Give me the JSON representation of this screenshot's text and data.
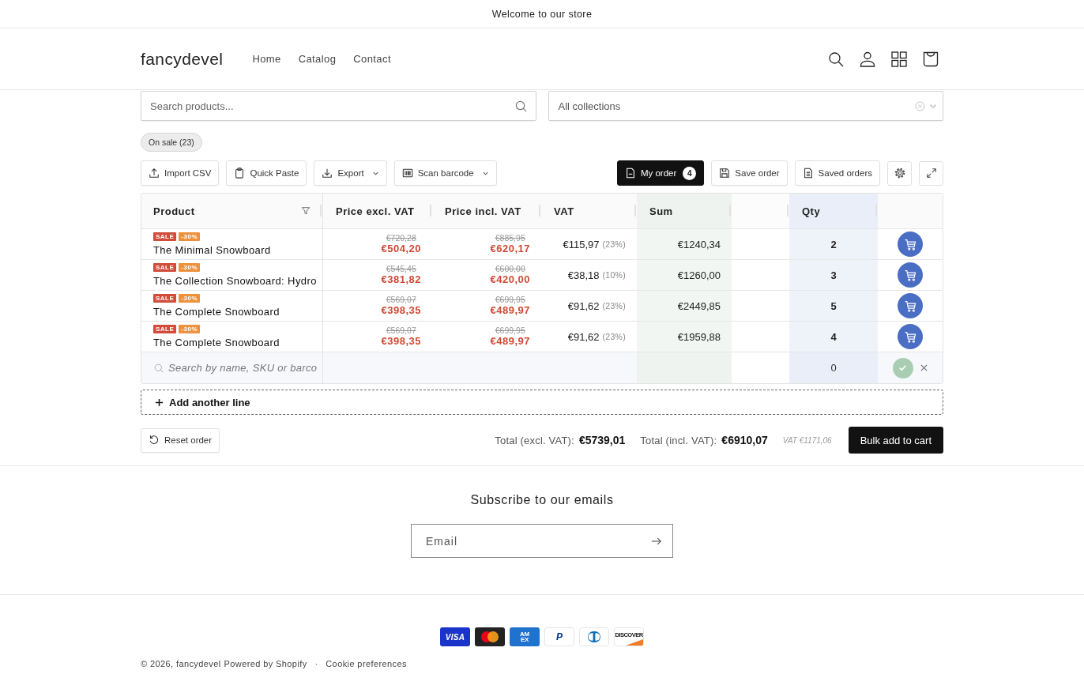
{
  "announcement": "Welcome to our store",
  "header": {
    "logo": "fancydevel",
    "nav": [
      {
        "label": "Home"
      },
      {
        "label": "Catalog"
      },
      {
        "label": "Contact"
      }
    ]
  },
  "filters": {
    "search": {
      "placeholder": "Search products..."
    },
    "collections": {
      "value": "All collections"
    },
    "chips": [
      {
        "label": "On sale (23)"
      }
    ]
  },
  "toolbar": {
    "left": [
      {
        "label": "Import CSV",
        "dropdown": false
      },
      {
        "label": "Quick Paste",
        "dropdown": false
      },
      {
        "label": "Export",
        "dropdown": true
      },
      {
        "label": "Scan barcode",
        "dropdown": true
      }
    ],
    "my_order": {
      "label": "My order",
      "count": "4",
      "active": true
    },
    "right": [
      {
        "label": "Save order"
      },
      {
        "label": "Saved orders"
      }
    ]
  },
  "table": {
    "columns": [
      "Product",
      "Price excl. VAT",
      "Price incl. VAT",
      "VAT",
      "Sum",
      "Qty"
    ],
    "rows": [
      {
        "badges": [
          {
            "label": "SALE",
            "color": "#d34b3b"
          },
          {
            "label": "-30%",
            "color": "#ef913b"
          }
        ],
        "name": "The Minimal Snowboard",
        "price_excl_old": "€720,28",
        "price_excl": "€504,20",
        "price_incl_old": "€885,95",
        "price_incl": "€620,17",
        "vat": "€115,97",
        "vat_rate": "(23%)",
        "sum": "€1240,34",
        "qty": "2"
      },
      {
        "badges": [
          {
            "label": "SALE",
            "color": "#d34b3b"
          },
          {
            "label": "-30%",
            "color": "#ef913b"
          }
        ],
        "name": "The Collection Snowboard: Hydro",
        "price_excl_old": "€545,45",
        "price_excl": "€381,82",
        "price_incl_old": "€600,00",
        "price_incl": "€420,00",
        "vat": "€38,18",
        "vat_rate": "(10%)",
        "sum": "€1260,00",
        "qty": "3"
      },
      {
        "badges": [
          {
            "label": "SALE",
            "color": "#d34b3b"
          },
          {
            "label": "-30%",
            "color": "#ef913b"
          }
        ],
        "name": "The Complete Snowboard",
        "price_excl_old": "€569,07",
        "price_excl": "€398,35",
        "price_incl_old": "€699,95",
        "price_incl": "€489,97",
        "vat": "€91,62",
        "vat_rate": "(23%)",
        "sum": "€2449,85",
        "qty": "5"
      },
      {
        "badges": [
          {
            "label": "SALE",
            "color": "#d34b3b"
          },
          {
            "label": "-30%",
            "color": "#ef913b"
          }
        ],
        "name": "The Complete Snowboard",
        "price_excl_old": "€569,07",
        "price_excl": "€398,35",
        "price_incl_old": "€699,95",
        "price_incl": "€489,97",
        "vat": "€91,62",
        "vat_rate": "(23%)",
        "sum": "€1959,88",
        "qty": "4"
      }
    ],
    "new_line": {
      "placeholder": "Search by name, SKU or barco",
      "qty": "0",
      "confirm_disabled": true
    }
  },
  "add_line": {
    "label": "Add another line"
  },
  "totals": {
    "reset": "Reset order",
    "excl_label": "Total (excl. VAT):",
    "excl_value": "€5739,01",
    "incl_label": "Total (incl. VAT):",
    "incl_value": "€6910,07",
    "vat_note": "VAT €1171,06",
    "submit": "Bulk add to cart"
  },
  "newsletter": {
    "title": "Subscribe to our emails",
    "email": {
      "placeholder": "Email"
    }
  },
  "payments": [
    {
      "kind": "visa",
      "label": "VISA"
    },
    {
      "kind": "mastercard"
    },
    {
      "kind": "amex",
      "label": "AM EX"
    },
    {
      "kind": "paypal",
      "label": "P"
    },
    {
      "kind": "diners"
    },
    {
      "kind": "discover",
      "label": "DISCOVER"
    }
  ],
  "footer": {
    "copyright": "© 2026, fancydevel",
    "powered_by": "Powered by Shopify",
    "separator": "·",
    "cookie_link": "Cookie preferences"
  }
}
